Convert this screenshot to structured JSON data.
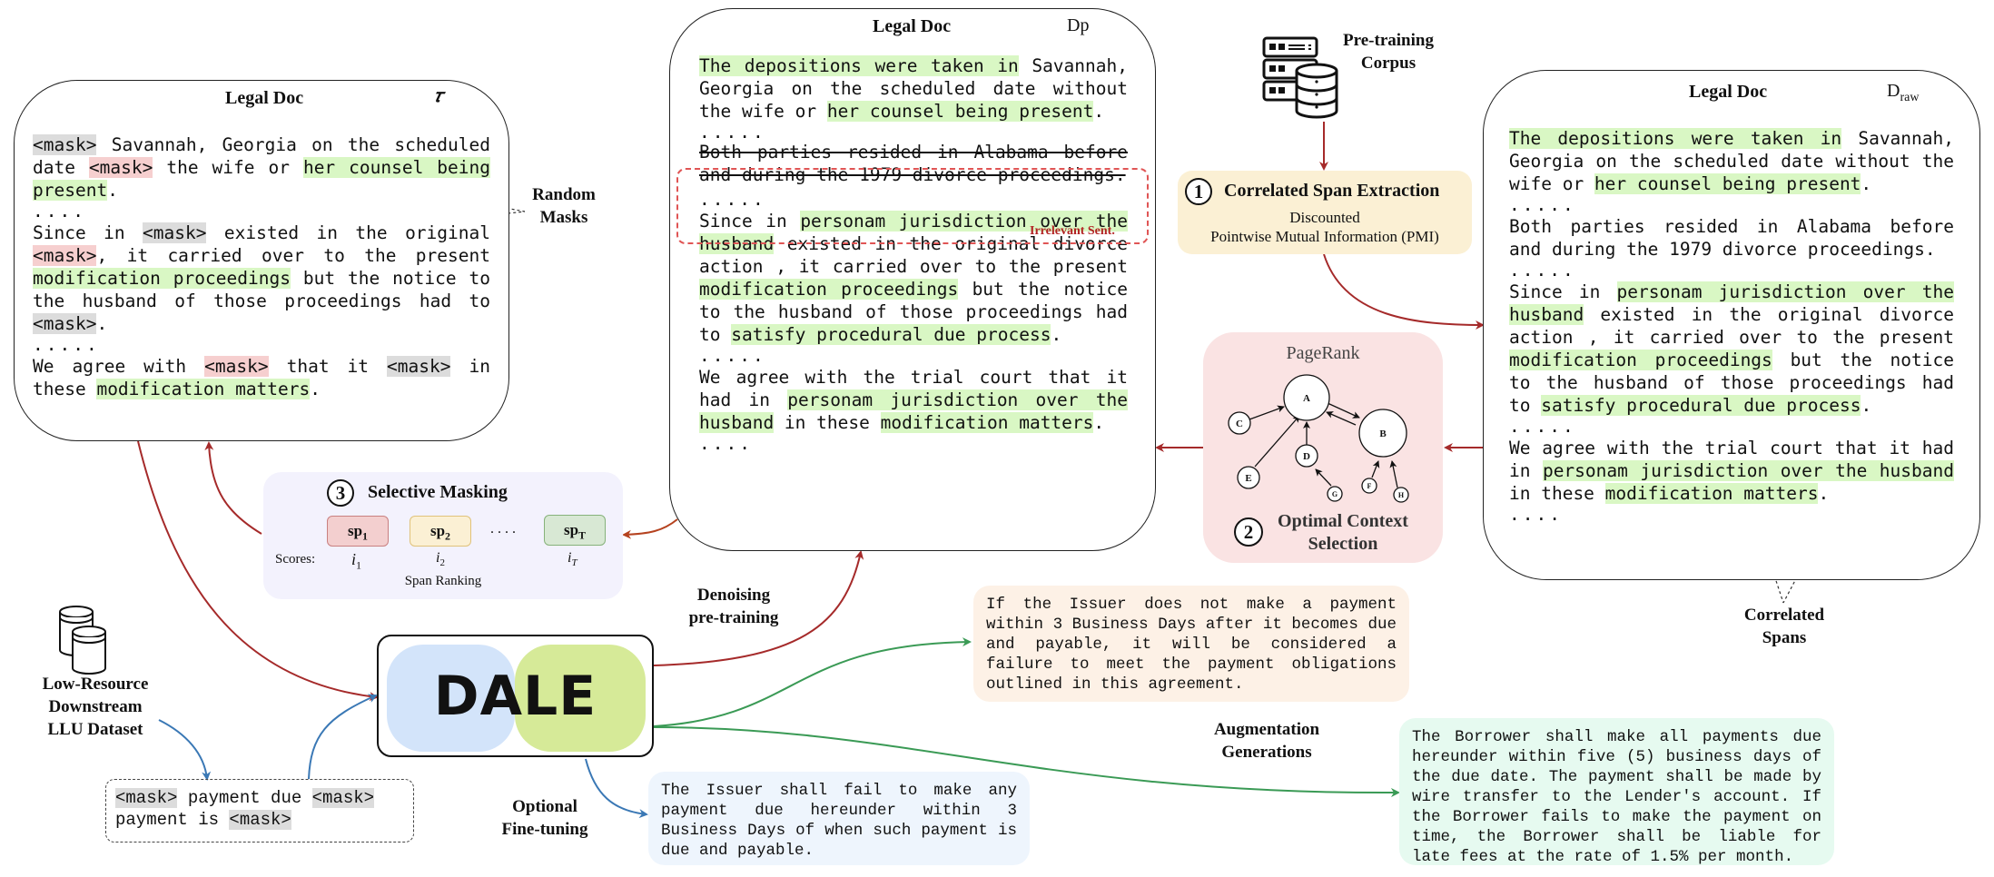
{
  "colors": {
    "span_highlight": "#d9f7c4",
    "mask_gray": "#dcdcdc",
    "mask_red": "#f6cfcf",
    "pretrain_arrow": "#a52a2a",
    "finetune_arrow": "#3a78b5",
    "augment_arrow": "#3a9a55",
    "step1_panel": "#fbf0d4",
    "step2_panel": "#fae3e3",
    "step3_panel": "#f3f2fd",
    "dale_left": "#d3e4fa",
    "dale_right": "#d6ea98"
  },
  "doc_masked": {
    "title": "Legal Doc",
    "symbol": "𝜏",
    "para1": [
      {
        "t": "<mask>",
        "h": "m"
      },
      {
        "t": " Savannah, Georgia on the scheduled date "
      },
      {
        "t": "<mask>",
        "h": "r"
      },
      {
        "t": " the wife or "
      },
      {
        "t": "her counsel being present",
        "h": "g"
      },
      {
        "t": "."
      }
    ],
    "dots1": "....",
    "para2": [
      {
        "t": "Since in "
      },
      {
        "t": "<mask>",
        "h": "m"
      },
      {
        "t": " existed in the original "
      },
      {
        "t": "<mask>",
        "h": "r"
      },
      {
        "t": ", it carried over to the present "
      },
      {
        "t": "modification proceedings",
        "h": "g"
      },
      {
        "t": " but the notice to the husband of those proceedings had to "
      },
      {
        "t": "<mask>",
        "h": "m"
      },
      {
        "t": "."
      }
    ],
    "dots2": ".....",
    "para3": [
      {
        "t": "We agree with "
      },
      {
        "t": "<mask>",
        "h": "r"
      },
      {
        "t": " that it "
      },
      {
        "t": "<mask>",
        "h": "m"
      },
      {
        "t": " in these "
      },
      {
        "t": "modification matters",
        "h": "g"
      },
      {
        "t": "."
      }
    ]
  },
  "random_masks_label": [
    "Random",
    "Masks"
  ],
  "doc_pruned": {
    "title": "Legal Doc",
    "symbol": "Dp",
    "para1": [
      {
        "t": "The depositions were taken in",
        "h": "g"
      },
      {
        "t": " Savannah, Georgia on the scheduled date without the wife or "
      },
      {
        "t": "her counsel being present",
        "h": "g"
      },
      {
        "t": "."
      }
    ],
    "dots1": ".....",
    "irrelevant": "Both parties resided in Alabama before and during the 1979 divorce proceedings.",
    "irrelevant_label": "Irrelevant Sent.",
    "dots2": ".....",
    "para2": [
      {
        "t": "Since in "
      },
      {
        "t": "personam jurisdiction over the husband",
        "h": "g"
      },
      {
        "t": " existed in the original divorce action , it carried over to the present "
      },
      {
        "t": "modification proceedings",
        "h": "g"
      },
      {
        "t": " but the notice to the husband of those proceedings had to "
      },
      {
        "t": "satisfy procedural due process",
        "h": "g"
      },
      {
        "t": "."
      }
    ],
    "dots3": ".....",
    "para3": [
      {
        "t": "We agree with the trial court that it had in "
      },
      {
        "t": "personam jurisdiction over the husband",
        "h": "g"
      },
      {
        "t": " in these "
      },
      {
        "t": "modification matters",
        "h": "g"
      },
      {
        "t": "."
      }
    ],
    "dots4": "...."
  },
  "doc_raw": {
    "title": "Legal Doc",
    "symbol_main": "D",
    "symbol_sub": "raw",
    "para1": [
      {
        "t": "The depositions were taken in",
        "h": "g"
      },
      {
        "t": " Savannah, Georgia on the scheduled date without the wife or "
      },
      {
        "t": "her counsel being present",
        "h": "g"
      },
      {
        "t": "."
      }
    ],
    "dots1": ".....",
    "para_irrelevant": "Both parties resided in Alabama before and during the 1979 divorce proceedings.",
    "dots2": ".....",
    "para2": [
      {
        "t": "Since in "
      },
      {
        "t": "personam jurisdiction over the husband",
        "h": "g"
      },
      {
        "t": " existed in the original divorce action , it carried over to the present "
      },
      {
        "t": "modification proceedings",
        "h": "g"
      },
      {
        "t": " but the notice to the husband of those proceedings had to "
      },
      {
        "t": "satisfy procedural due process",
        "h": "g"
      },
      {
        "t": "."
      }
    ],
    "dots3": ".....",
    "para3": [
      {
        "t": "We agree with the trial court that it had in "
      },
      {
        "t": "personam jurisdiction over the husband",
        "h": "g"
      },
      {
        "t": " in these "
      },
      {
        "t": "modification matters",
        "h": "g"
      },
      {
        "t": "."
      }
    ],
    "dots4": "...."
  },
  "correlated_spans_label": [
    "Correlated",
    "Spans"
  ],
  "pretraining_corpus_label": [
    "Pre-training",
    "Corpus"
  ],
  "step1": {
    "number": "1",
    "title": "Correlated Span Extraction",
    "line1": "Discounted",
    "line2": "Pointwise Mutual Information (PMI)"
  },
  "step2": {
    "number": "2",
    "graph_title": "PageRank",
    "title_line1": "Optimal Context",
    "title_line2": "Selection",
    "nodes": [
      "A",
      "B",
      "C",
      "D",
      "E",
      "F",
      "G",
      "H"
    ]
  },
  "step3": {
    "number": "3",
    "title": "Selective Masking",
    "spans": [
      {
        "label": "sp",
        "sub": "1",
        "score": "i",
        "score_sub": "1"
      },
      {
        "label": "sp",
        "sub": "2",
        "score": "i",
        "score_sub": "2"
      },
      {
        "label": "sp",
        "sub": "T",
        "score": "i",
        "score_sub": "T"
      }
    ],
    "ellipsis": ". . . .",
    "scores_label": "Scores:",
    "caption": "Span Ranking"
  },
  "dale_label": "DALE",
  "denoising_label": [
    "Denoising",
    "pre-training"
  ],
  "low_resource_label": [
    "Low-Resource",
    "Downstream",
    "LLU Dataset"
  ],
  "masked_example": [
    {
      "t": "<mask>",
      "h": "m"
    },
    {
      "t": " payment due "
    },
    {
      "t": "<mask>",
      "h": "m"
    },
    {
      "t": " payment is "
    },
    {
      "t": "<mask>",
      "h": "m"
    }
  ],
  "optional_finetuning_label": [
    "Optional",
    "Fine-tuning"
  ],
  "augmentation_label": [
    "Augmentation",
    "Generations"
  ],
  "generations": [
    "If the Issuer does not make a payment within 3 Business Days after it becomes due and payable, it will be considered a failure to meet the payment obligations outlined in this agreement.",
    "The Issuer shall fail to make any payment due hereunder within 3 Business Days of when such payment is due and payable.",
    "The Borrower shall make all payments due hereunder within five (5) business days of the due date. The payment shall be made by wire transfer to the Lender's account. If the Borrower fails to make the payment on time, the Borrower shall be liable for late fees at the rate of 1.5% per month."
  ]
}
